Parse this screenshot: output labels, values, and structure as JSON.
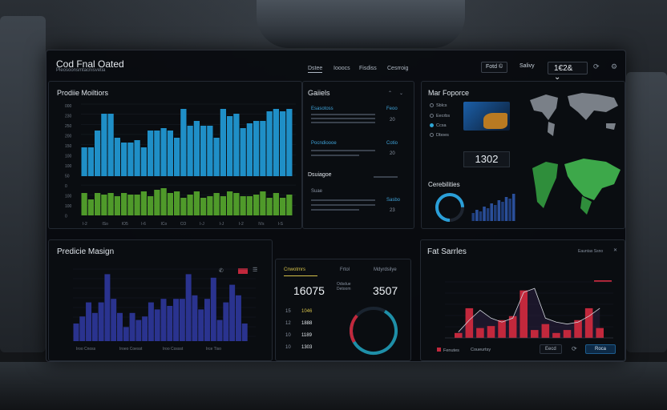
{
  "header": {
    "title": "Cod Fnal Oated",
    "subtitle": "Pleosoonsmtacnisvetia",
    "tabs": [
      "Dstee",
      "Iooocs",
      "Fisdiss",
      "Cesrroig"
    ],
    "buttons": [
      "Fotd ©",
      "Salivy"
    ],
    "readout": "1€2& ⌄",
    "icons": [
      "refresh-icon",
      "settings-icon"
    ]
  },
  "prod_monitors": {
    "title": "Prodiie Moiltiors",
    "y_labels": [
      "000",
      "230",
      "250",
      "200",
      "150",
      "100",
      "100",
      "50",
      "0",
      "100",
      "100",
      "0"
    ],
    "x_labels": [
      "I-2",
      "ISo",
      "IO5",
      "I-6",
      "ICo",
      "CO",
      "I-J",
      "I-J",
      "I-2",
      "IVs",
      "I-S"
    ],
    "chart_data": {
      "type": "bar",
      "series": [
        {
          "color": "#1f8fc7",
          "values": [
            60,
            60,
            95,
            130,
            130,
            80,
            70,
            70,
            75,
            60,
            95,
            95,
            100,
            95,
            80,
            140,
            105,
            115,
            105,
            105,
            80,
            140,
            125,
            130,
            100,
            110,
            115,
            115,
            135,
            140,
            135,
            140
          ]
        },
        {
          "color": "#4f9a2a",
          "values": [
            70,
            50,
            70,
            65,
            70,
            60,
            70,
            65,
            65,
            75,
            60,
            80,
            85,
            70,
            75,
            55,
            65,
            75,
            55,
            60,
            70,
            60,
            75,
            70,
            60,
            60,
            65,
            75,
            55,
            70,
            55,
            65
          ]
        }
      ]
    }
  },
  "gadgets": {
    "title": "Gaiiels",
    "controls": [
      "⌃",
      "⌄"
    ],
    "section2": "Dsuiagoe",
    "rows": [
      {
        "label": "Esasotoss",
        "tag": "Feoo",
        "value": "20"
      },
      {
        "label": "Pocndioooe",
        "tag": "Cotio",
        "value": "20"
      },
      {
        "label": "Suae",
        "tag": "Sasbo",
        "value": "23"
      }
    ]
  },
  "map_features": {
    "title": "Mar Foporce",
    "options": [
      "Sblcs",
      "Eecrbs",
      "Ccsa",
      "Dboes"
    ],
    "display": "1302"
  },
  "capabilities": {
    "title": "Cerebilities"
  },
  "predictive": {
    "title": "Predicie Masign",
    "x_labels": [
      "Iroo Cnoss",
      "Iroeo Coesst",
      "Iroo Cossst",
      "Irce Tiso"
    ],
    "chart_data": {
      "type": "bar",
      "series": [
        {
          "color": "#2a338f",
          "values": [
            25,
            35,
            55,
            40,
            55,
            95,
            60,
            40,
            20,
            40,
            30,
            35,
            55,
            45,
            60,
            50,
            60,
            60,
            95,
            65,
            45,
            60,
            90,
            30,
            55,
            80,
            65,
            25
          ]
        }
      ]
    }
  },
  "stats": {
    "tabs": [
      "Cnwotmrs",
      "Frtol",
      "Mdyrdsilye"
    ],
    "value_left": "16075",
    "value_right": "3507",
    "sub_label": "Odsdue\nDetoom",
    "rows": [
      {
        "k": "15",
        "v": "1046"
      },
      {
        "k": "12",
        "v": "1888"
      },
      {
        "k": "10",
        "v": "1189"
      },
      {
        "k": "10",
        "v": "1303"
      }
    ],
    "gauge_pct": 0.72
  },
  "fat_series": {
    "title": "Fat Sarrles",
    "controls": [
      "Eauntas Ssno"
    ],
    "legend": [
      "Fenutes",
      "Coueurtsy"
    ],
    "buttons": [
      "Eecd",
      "Roca"
    ],
    "chart_data": {
      "type": "bar",
      "bars": [
        5,
        30,
        10,
        12,
        18,
        22,
        48,
        8,
        14,
        5,
        8,
        18,
        30,
        10
      ],
      "line": [
        6,
        18,
        28,
        20,
        16,
        20,
        46,
        50,
        20,
        16,
        14,
        16,
        22,
        30
      ]
    }
  },
  "colors": {
    "accent_blue": "#1f8fc7",
    "accent_green": "#4f9a2a",
    "accent_red": "#c2283c",
    "navy": "#2a338f"
  }
}
